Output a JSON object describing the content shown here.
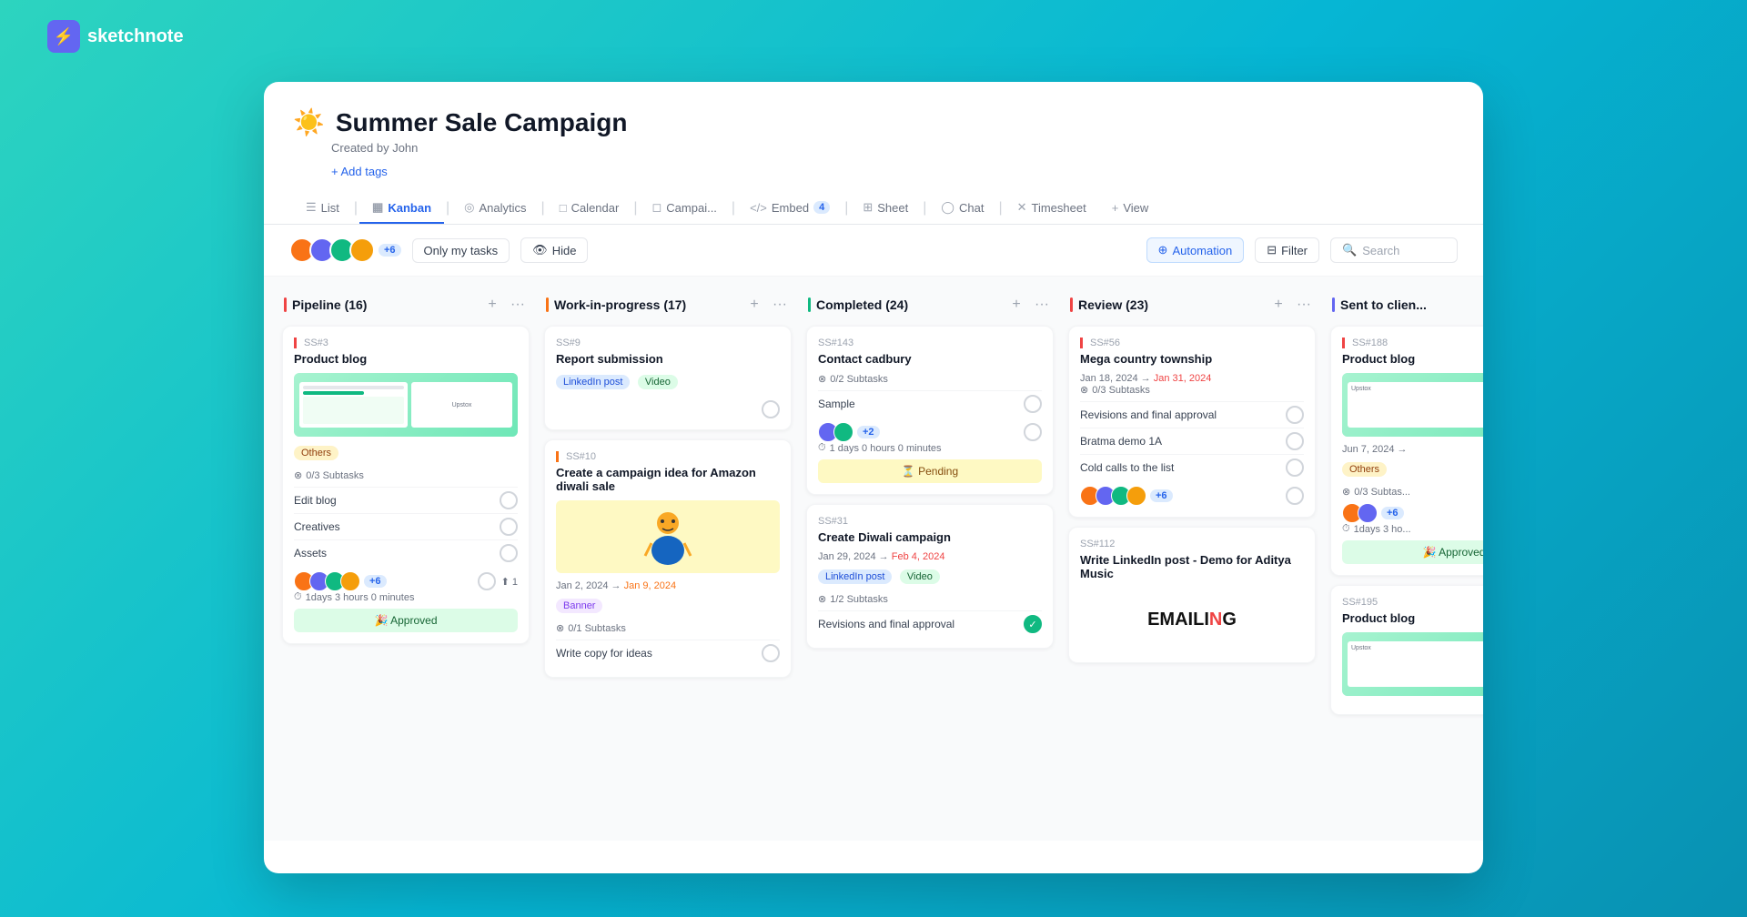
{
  "app": {
    "logo_text": "sketchnote",
    "logo_icon": "⚡"
  },
  "project": {
    "emoji": "☀️",
    "title": "Summer Sale Campaign",
    "created_by": "Created by John",
    "add_tags": "+ Add tags"
  },
  "nav": {
    "tabs": [
      {
        "id": "list",
        "icon": "☰",
        "label": "List"
      },
      {
        "id": "kanban",
        "icon": "▦",
        "label": "Kanban",
        "active": true
      },
      {
        "id": "analytics",
        "icon": "◎",
        "label": "Analytics"
      },
      {
        "id": "calendar",
        "icon": "□",
        "label": "Calendar"
      },
      {
        "id": "campaign",
        "icon": "◻",
        "label": "Campai..."
      },
      {
        "id": "embed",
        "icon": "</>",
        "label": "Embed",
        "badge": "4"
      },
      {
        "id": "sheet",
        "icon": "⊞",
        "label": "Sheet"
      },
      {
        "id": "chat",
        "icon": "◯",
        "label": "Chat"
      },
      {
        "id": "timesheet",
        "icon": "✕",
        "label": "Timesheet"
      },
      {
        "id": "view",
        "icon": "+",
        "label": "View"
      }
    ]
  },
  "toolbar": {
    "my_tasks_label": "Only my tasks",
    "hide_label": "Hide",
    "automation_label": "Automation",
    "filter_label": "Filter",
    "search_placeholder": "Search",
    "avatar_count": "+6"
  },
  "columns": [
    {
      "id": "pipeline",
      "title": "Pipeline (16)",
      "color": "#ef4444",
      "cards": [
        {
          "id": "SS#3",
          "name": "Product blog",
          "has_image": true,
          "image_type": "slides",
          "tags": [
            {
              "label": "Others",
              "type": "others"
            }
          ],
          "subtasks": "0/3 Subtasks",
          "tasks": [
            "Edit blog",
            "Creatives",
            "Assets"
          ],
          "avatars": 4,
          "avatar_count": "+6",
          "has_upload": true,
          "time": "1days 3 hours 0 minutes",
          "status": "Approved",
          "status_type": "approved"
        }
      ]
    },
    {
      "id": "wip",
      "title": "Work-in-progress (17)",
      "color": "#f97316",
      "cards": [
        {
          "id": "SS#9",
          "name": "Report submission",
          "tags": [
            {
              "label": "LinkedIn post",
              "type": "linkedin"
            },
            {
              "label": "Video",
              "type": "video"
            }
          ],
          "has_circle": true
        },
        {
          "id": "SS#10",
          "name": "Create a campaign idea for Amazon diwali sale",
          "has_image": true,
          "image_type": "amazon",
          "date_start": "Jan 2, 2024",
          "date_end": "Jan 9, 2024",
          "tags": [
            {
              "label": "Banner",
              "type": "banner"
            }
          ],
          "subtasks": "0/1 Subtasks",
          "tasks": [
            "Write copy for ideas"
          ]
        }
      ]
    },
    {
      "id": "completed",
      "title": "Completed (24)",
      "color": "#10b981",
      "cards": [
        {
          "id": "SS#143",
          "name": "Contact cadbury",
          "subtasks": "0/2 Subtasks",
          "sub_tasks": [
            "Sample"
          ],
          "avatars": 2,
          "avatar_count": "+2",
          "time": "1 days 0 hours 0 minutes",
          "status": "Pending",
          "status_type": "pending"
        },
        {
          "id": "SS#31",
          "name": "Create Diwali campaign",
          "date_start": "Jan 29, 2024",
          "date_end": "Feb 4, 2024",
          "tags": [
            {
              "label": "LinkedIn post",
              "type": "linkedin"
            },
            {
              "label": "Video",
              "type": "video"
            }
          ],
          "subtasks": "1/2 Subtasks",
          "tasks": [
            "Revisions and final approval"
          ],
          "task_done": true
        }
      ]
    },
    {
      "id": "review",
      "title": "Review (23)",
      "color": "#ef4444",
      "cards": [
        {
          "id": "SS#56",
          "name": "Mega country township",
          "date_start": "Jan 18, 2024",
          "date_end": "Jan 31, 2024",
          "date_end_overdue": true,
          "subtasks": "0/3 Subtasks",
          "tasks": [
            "Revisions and final approval",
            "Bratma demo 1A",
            "Cold calls to the list"
          ],
          "avatars": 4,
          "avatar_count": "+6"
        },
        {
          "id": "SS#112",
          "name": "Write LinkedIn post - Demo for Aditya Music",
          "has_image": true,
          "image_type": "emailing"
        }
      ]
    },
    {
      "id": "sent",
      "title": "Sent to client",
      "color": "#6366f1",
      "cards": [
        {
          "id": "SS#188",
          "name": "Product blog",
          "has_image": true,
          "image_type": "slides",
          "date_start": "Jun 7, 2024",
          "date_end": "",
          "tags": [
            {
              "label": "Others",
              "type": "others"
            }
          ],
          "subtasks": "0/3 Subtas",
          "avatars": 4,
          "avatar_count": "+6",
          "time": "1days 3 ho",
          "status": "Approved",
          "status_type": "approved"
        },
        {
          "id": "SS#195",
          "name": "Product blog",
          "has_image": true,
          "image_type": "slides"
        }
      ]
    }
  ]
}
